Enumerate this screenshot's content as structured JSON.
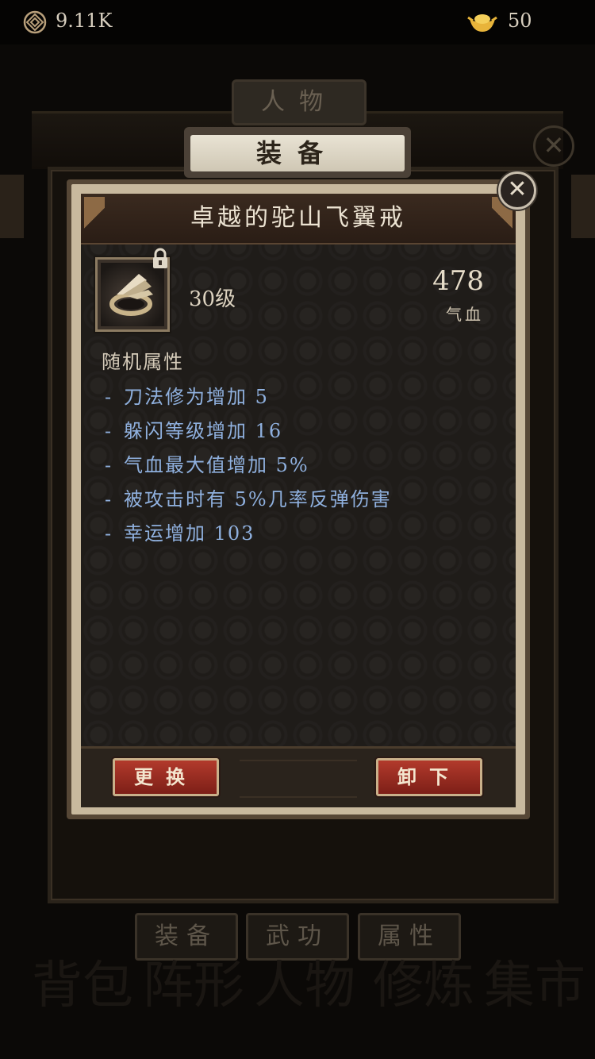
{
  "topbar": {
    "coins": "9.11K",
    "ingots": "50",
    "coin_icon": "coin-icon",
    "ingot_icon": "gold-ingot-icon"
  },
  "background": {
    "tab_title": "人物",
    "bottom_tabs": [
      "装备",
      "武功",
      "属性"
    ],
    "ghost_nav": [
      "背包",
      "阵形",
      "人物",
      "修炼",
      "集市"
    ]
  },
  "dialog": {
    "header_tab": "装备",
    "close_symbol": "✕",
    "item_name": "卓越的驼山飞翼戒",
    "level": "30级",
    "main_stat_value": "478",
    "main_stat_label": "气血",
    "random_attr_title": "随机属性",
    "attributes": [
      "刀法修为增加 5",
      "躲闪等级增加 16",
      "气血最大值增加 5%",
      "被攻击时有 5%几率反弹伤害",
      "幸运增加 103"
    ],
    "buttons": {
      "replace": "更换",
      "unequip": "卸下"
    }
  },
  "colors": {
    "attribute_text": "#8fb0de",
    "button_red": "#b23a2c",
    "panel_bg": "#1f1c19"
  }
}
